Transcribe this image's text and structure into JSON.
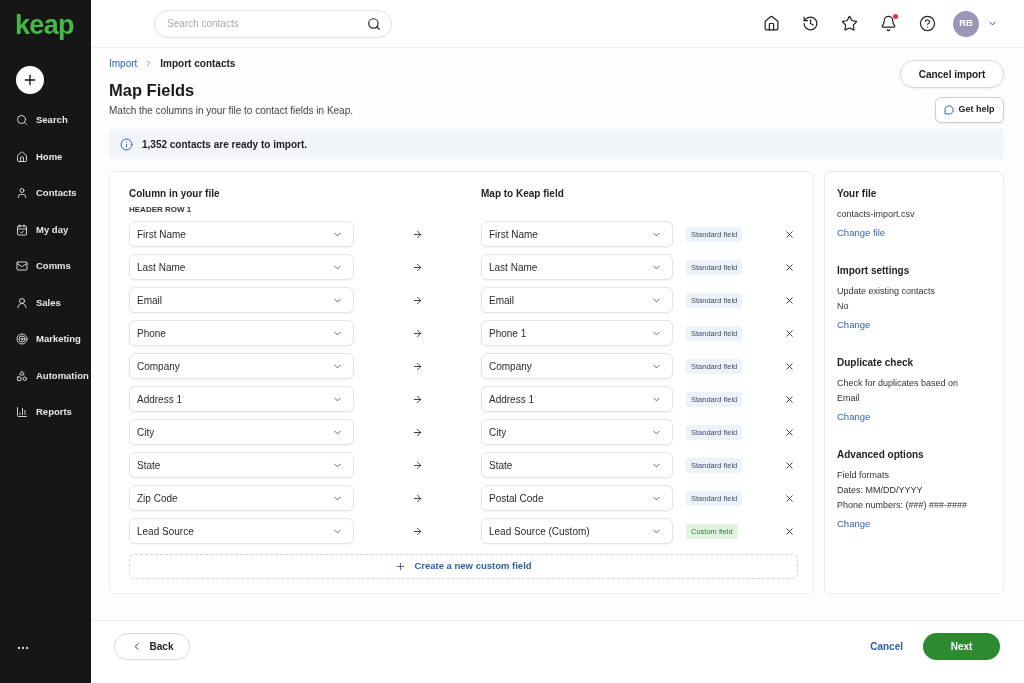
{
  "sidebar": {
    "logo": "keap",
    "items": [
      {
        "label": "Search"
      },
      {
        "label": "Home"
      },
      {
        "label": "Contacts"
      },
      {
        "label": "My day"
      },
      {
        "label": "Comms"
      },
      {
        "label": "Sales"
      },
      {
        "label": "Marketing"
      },
      {
        "label": "Automation"
      },
      {
        "label": "Reports"
      }
    ]
  },
  "topbar": {
    "search": {
      "placeholder": "Search contacts"
    },
    "notification_dot": true,
    "avatar": "RB"
  },
  "breadcrumb": [
    {
      "label": "Import",
      "current": false
    },
    {
      "label": "Import contacts",
      "current": true
    }
  ],
  "title": "Map Fields",
  "subtitle": "Match the columns in your file to contact fields in Keap.",
  "actions": {
    "cancel_import": "Cancel import",
    "get_help": "Get help"
  },
  "banner": "1,352 contacts are ready to import.",
  "mapping": {
    "column_header": "Column in your file",
    "header_row": "HEADER ROW 1",
    "field_header": "Map to Keap field",
    "rows": [
      {
        "column": "First Name",
        "field": "First Name",
        "kind": "standard",
        "badge": "Standard field"
      },
      {
        "column": "Last Name",
        "field": "Last Name",
        "kind": "standard",
        "badge": "Standard field"
      },
      {
        "column": "Email",
        "field": "Email",
        "kind": "standard",
        "badge": "Standard field"
      },
      {
        "column": "Phone",
        "field": "Phone 1",
        "kind": "standard",
        "badge": "Standard field"
      },
      {
        "column": "Company",
        "field": "Company",
        "kind": "standard",
        "badge": "Standard field"
      },
      {
        "column": "Address 1",
        "field": "Address 1",
        "kind": "standard",
        "badge": "Standard field"
      },
      {
        "column": "City",
        "field": "City",
        "kind": "standard",
        "badge": "Standard field"
      },
      {
        "column": "State",
        "field": "State",
        "kind": "standard",
        "badge": "Standard field"
      },
      {
        "column": "Zip Code",
        "field": "Postal Code",
        "kind": "standard",
        "badge": "Standard field"
      },
      {
        "column": "Lead Source",
        "field": "Lead Source (Custom)",
        "kind": "custom",
        "badge": "Custom field"
      }
    ],
    "create_button": "Create a new custom field"
  },
  "summary": {
    "sections": [
      {
        "heading": "Your file",
        "lines": [
          "contacts-import.csv"
        ],
        "link": "Change file"
      },
      {
        "heading": "Import settings",
        "lines": [
          "Update existing contacts",
          "No"
        ],
        "link": "Change"
      },
      {
        "heading": "Duplicate check",
        "lines": [
          "Check for duplicates based on",
          "Email"
        ],
        "link": "Change"
      },
      {
        "heading": "Advanced options",
        "lines": [
          "Field formats",
          "Dates: MM/DD/YYYY",
          "Phone numbers: (###) ###-####"
        ],
        "link": "Change"
      }
    ]
  },
  "footer": {
    "back": "Back",
    "cancel": "Cancel",
    "next": "Next"
  }
}
